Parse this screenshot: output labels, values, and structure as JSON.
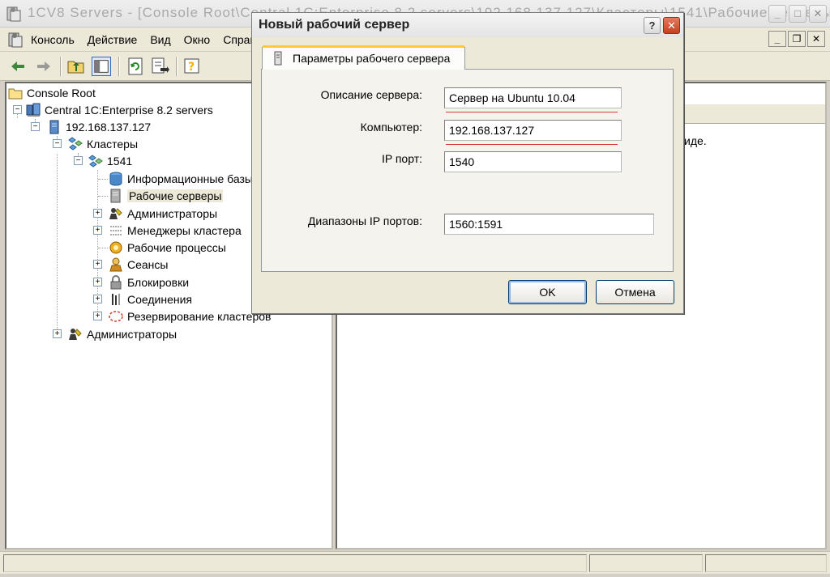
{
  "window": {
    "title": "1CV8 Servers - [Console Root\\Central 1C:Enterprise 8.2 servers\\192.168.137.127\\Кластеры\\1541\\Рабочие серверы]"
  },
  "menu": {
    "items": [
      "Консоль",
      "Действие",
      "Вид",
      "Окно",
      "Справка"
    ]
  },
  "toolbar": {
    "buttons": [
      "back-icon",
      "forward-icon",
      "up-folder-icon",
      "show-hide-tree-icon",
      "refresh-icon",
      "export-list-icon",
      "help-icon"
    ]
  },
  "tree": {
    "root": "Console Root",
    "central": "Central 1C:Enterprise 8.2 servers",
    "server": "192.168.137.127",
    "clusters": "Кластеры",
    "cluster": "1541",
    "cluster_children": [
      "Информационные базы",
      "Рабочие серверы",
      "Администраторы",
      "Менеджеры кластера",
      "Рабочие процессы",
      "Сеансы",
      "Блокировки",
      "Соединения",
      "Резервирование кластеров"
    ],
    "server_admins": "Администраторы",
    "selected": "Рабочие серверы"
  },
  "right_pane": {
    "text": "иде."
  },
  "dialog": {
    "title": "Новый рабочий сервер",
    "help_label": "?",
    "close_label": "✕",
    "tab_label": "Параметры рабочего сервера",
    "fields": {
      "description_label": "Описание сервера:",
      "description_value": "Сервер на Ubuntu 10.04",
      "computer_label": "Компьютер:",
      "computer_value": "192.168.137.127",
      "port_label": "IP порт:",
      "port_value": "1540",
      "range_label": "Диапазоны IP портов:",
      "range_value": "1560:1591"
    },
    "ok_label": "OK",
    "cancel_label": "Отмена"
  },
  "colors": {
    "accent_tab": "#ffc83c",
    "underline_red": "#d83a3a",
    "close_button": "#c6401f"
  }
}
